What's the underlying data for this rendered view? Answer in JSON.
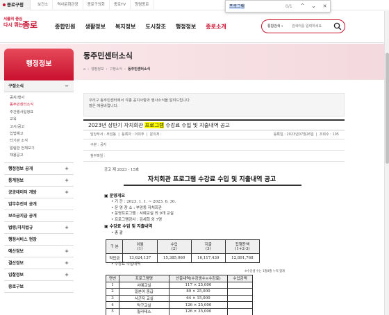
{
  "topbar": {
    "home": "종로구청",
    "links": [
      "보건소",
      "역사문화관광",
      "종로구의회",
      "종로TV",
      "청렴종로"
    ]
  },
  "findbar": {
    "query": "프로그램",
    "count": "0/1",
    "up": "⌃",
    "down": "⌄",
    "close": "✕"
  },
  "header": {
    "logo_line1": "서울의 중심",
    "logo_line2": "다시 뛰는",
    "logo_name": "종로",
    "nav": [
      "종합민원",
      "생활정보",
      "복지정보",
      "도시창조",
      "행정정보",
      "종로소개"
    ],
    "search_category": "통합검색",
    "search_arrow": "▾",
    "search_placeholder": "검색어를 입력하세요.",
    "accent_color": "#c8102e"
  },
  "sidebar": {
    "title": "행정정보",
    "open_section": {
      "label": "구정소식",
      "toggle": "−"
    },
    "sub_items": [
      "공지/행사",
      "동주민센터소식",
      "주간행사일정표",
      "교육",
      "고시/공고",
      "입법예고",
      "타기관 소식",
      "알림판 전체보기",
      "채용공고"
    ],
    "current_index": 1,
    "sections": [
      {
        "label": "행정정보 공개",
        "toggle": "+"
      },
      {
        "label": "통계정보",
        "toggle": "+"
      },
      {
        "label": "공공데이터 개방",
        "toggle": "+"
      },
      {
        "label": "업무추진비 공개",
        "toggle": ""
      },
      {
        "label": "보조금지급 공개",
        "toggle": ""
      },
      {
        "label": "법령/자치법규",
        "toggle": "+"
      },
      {
        "label": "행정서비스 현장",
        "toggle": ""
      },
      {
        "label": "예산정보",
        "toggle": "+"
      },
      {
        "label": "결산정보",
        "toggle": "+"
      },
      {
        "label": "입찰정보",
        "toggle": "+"
      },
      {
        "label": "종로구보",
        "toggle": ""
      }
    ]
  },
  "page": {
    "title": "동주민센터소식",
    "breadcrumb": [
      "⌂",
      "›",
      "행정정보",
      "›",
      "구정소식",
      "›",
      "동주민센터소식"
    ]
  },
  "post": {
    "notice_line1": "우리구 동주민센터에서 각종 공지사항과 행사소식을 알려드립니다.",
    "notice_line2": "많은 애용바랍니다.",
    "title_pre": "2023년 상반기 자치회관 ",
    "title_mark": "프로그램",
    "title_post": " 수강료 수입 및 지출내역 공고",
    "dept": "담당부서 : 부암동",
    "writer": "등록자 : 이미주",
    "phone": "문의처 :",
    "date": "등록일 : 2023년07월26일",
    "views": "조회수 : 105",
    "category_label": "구분 : 공지",
    "attach_label": "첨부파일 :"
  },
  "doc": {
    "number": "공고 제 2023 - 15호",
    "title": "자치회관 프로그램 수강료 수입 및 지출내역 공고",
    "section1": "▣ 운영개요",
    "items": [
      "• 기        간 : 2023. 1. 1. ~ 2023. 6. 30.",
      "• 운  영  장  소 : 부암동 자치회관",
      "• 운영프로그램 : 서예교실 외 9개 교실",
      "• 프로그램강사 : 김세희 외 7명"
    ],
    "section2": "▣ 수강료 수입 및 지출내역",
    "total_label": "• 총    괄",
    "summary": {
      "header_label": "구  분",
      "headers": [
        "이월\n(1)",
        "수입\n(2)",
        "지출\n(3)",
        "집행잔액\n(1+2-3)"
      ],
      "row_label": "적립금",
      "values": [
        "13,624,137",
        "15,385,060",
        "16,117,439",
        "12,891,768"
      ]
    },
    "income_label": "• 수강료 수입내역",
    "unit_note": "※수강생 수는 1월4월 누적 합계",
    "income": {
      "headers": [
        "연번",
        "프로그램명",
        "산출내역(수강생수×수강료)",
        "수입금액"
      ],
      "rows": [
        [
          "1",
          "서예교실",
          "117 × 25,000",
          ""
        ],
        [
          "2",
          "일본어 중급",
          "89 × 25,000",
          ""
        ],
        [
          "3",
          "사군자 교실",
          "64 × 15,000",
          ""
        ],
        [
          "4",
          "탁구교실",
          "126 × 25,000",
          ""
        ],
        [
          "5",
          "필라테스",
          "126 × 35,000",
          ""
        ]
      ]
    }
  }
}
